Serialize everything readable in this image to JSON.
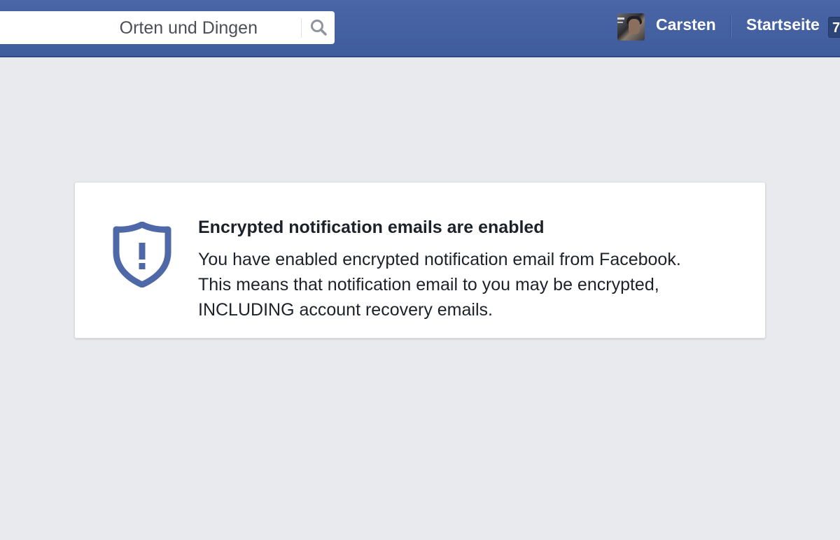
{
  "header": {
    "search": {
      "value": "Orten und Dingen",
      "icon": "search-icon"
    },
    "user": {
      "name": "Carsten",
      "avatar": "avatar-image"
    },
    "home": {
      "label": "Startseite",
      "badge": "7"
    },
    "colors": {
      "bar": "#3f5c9c",
      "accent": "#4267b2"
    }
  },
  "notice": {
    "icon": "shield-exclamation-icon",
    "title": "Encrypted notification emails are enabled",
    "lines": [
      "You have enabled encrypted notification email from Facebook.",
      "This means that notification email to you may be encrypted,",
      "INCLUDING account recovery emails."
    ],
    "icon_color": "#4f69a8"
  }
}
